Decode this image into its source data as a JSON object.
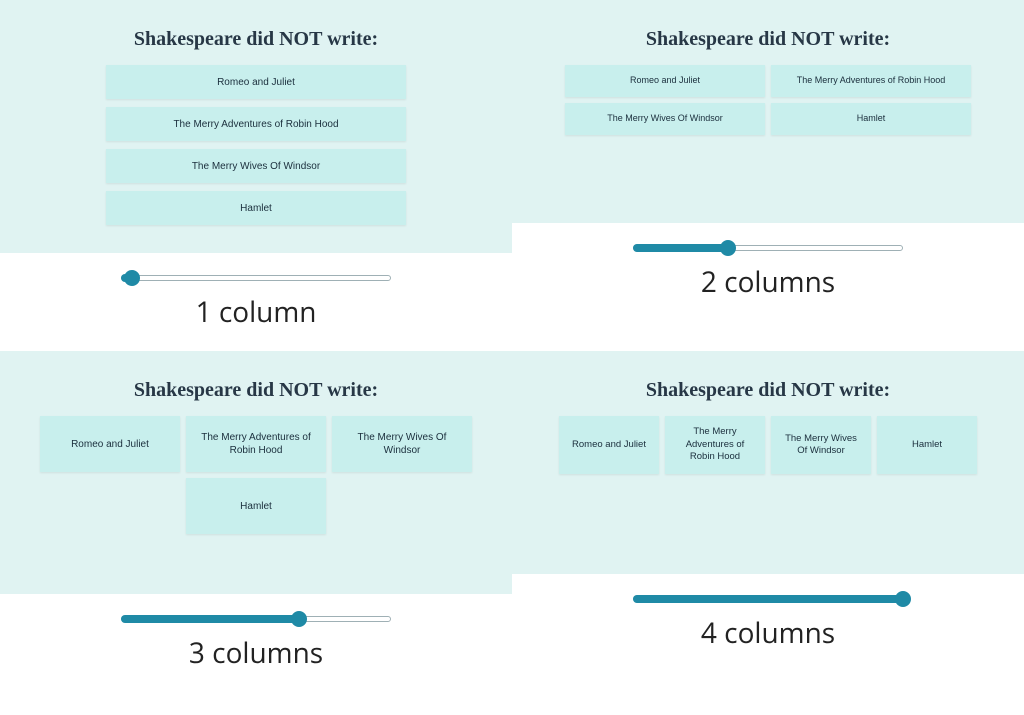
{
  "question": "Shakespeare did NOT write:",
  "answers": [
    "Romeo and Juliet",
    "The Merry Adventures of Robin Hood",
    "The Merry Wives Of Windsor",
    "Hamlet"
  ],
  "panels": [
    {
      "columns": 1,
      "caption": "1 column",
      "slider_percent": 4
    },
    {
      "columns": 2,
      "caption": "2 columns",
      "slider_percent": 35
    },
    {
      "columns": 3,
      "caption": "3 columns",
      "slider_percent": 66
    },
    {
      "columns": 4,
      "caption": "4 columns",
      "slider_percent": 100
    }
  ],
  "colors": {
    "panel_bg": "#e0f3f2",
    "answer_bg": "#c8efed",
    "slider": "#1f8aa6"
  }
}
